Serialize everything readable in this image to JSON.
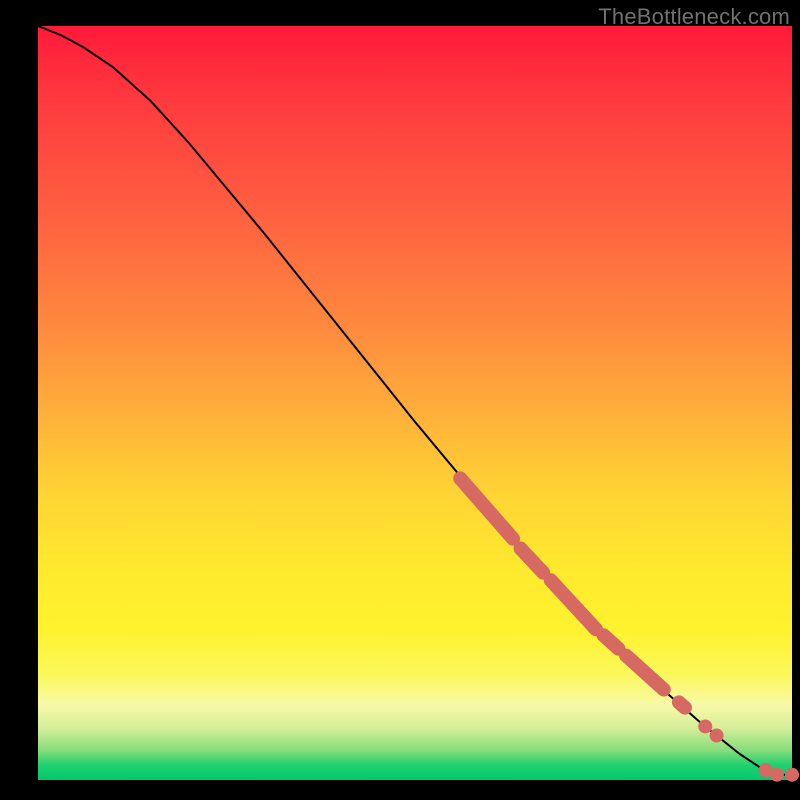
{
  "watermark": "TheBottleneck.com",
  "chart_data": {
    "type": "line",
    "title": "",
    "xlabel": "",
    "ylabel": "",
    "xlim": [
      0,
      100
    ],
    "ylim": [
      0,
      100
    ],
    "grid": false,
    "curve_points": [
      {
        "x": 0,
        "y": 100
      },
      {
        "x": 3,
        "y": 98.8
      },
      {
        "x": 6,
        "y": 97.2
      },
      {
        "x": 10,
        "y": 94.5
      },
      {
        "x": 15,
        "y": 90.0
      },
      {
        "x": 20,
        "y": 84.5
      },
      {
        "x": 30,
        "y": 72.5
      },
      {
        "x": 40,
        "y": 60.0
      },
      {
        "x": 50,
        "y": 47.5
      },
      {
        "x": 60,
        "y": 35.5
      },
      {
        "x": 70,
        "y": 24.5
      },
      {
        "x": 80,
        "y": 14.5
      },
      {
        "x": 88,
        "y": 7.5
      },
      {
        "x": 93,
        "y": 3.5
      },
      {
        "x": 96,
        "y": 1.5
      },
      {
        "x": 98,
        "y": 0.7
      },
      {
        "x": 100,
        "y": 0.7
      }
    ],
    "markers": {
      "thick_segments": [
        {
          "x1": 56,
          "y1": 40.0,
          "x2": 63,
          "y2": 32.0
        },
        {
          "x1": 64,
          "y1": 30.7,
          "x2": 67,
          "y2": 27.5
        },
        {
          "x1": 68,
          "y1": 26.5,
          "x2": 74,
          "y2": 20.0
        },
        {
          "x1": 75,
          "y1": 19.2,
          "x2": 77,
          "y2": 17.4
        },
        {
          "x1": 78,
          "y1": 16.5,
          "x2": 83,
          "y2": 12.0
        },
        {
          "x1": 85,
          "y1": 10.3,
          "x2": 85.8,
          "y2": 9.6
        }
      ],
      "dots": [
        {
          "x": 88.5,
          "y": 7.1
        },
        {
          "x": 90.0,
          "y": 5.9
        },
        {
          "x": 96.5,
          "y": 1.3
        },
        {
          "x": 98.0,
          "y": 0.7
        },
        {
          "x": 100.0,
          "y": 0.7
        }
      ],
      "dot_radius_px": 7
    },
    "background_gradient": {
      "direction": "top-to-bottom",
      "stops": [
        {
          "pos": 0.0,
          "color": "#ff1a3a"
        },
        {
          "pos": 0.5,
          "color": "#ffb53a"
        },
        {
          "pos": 0.78,
          "color": "#fff22e"
        },
        {
          "pos": 0.92,
          "color": "#e9f29e"
        },
        {
          "pos": 1.0,
          "color": "#00c96b"
        }
      ]
    }
  }
}
